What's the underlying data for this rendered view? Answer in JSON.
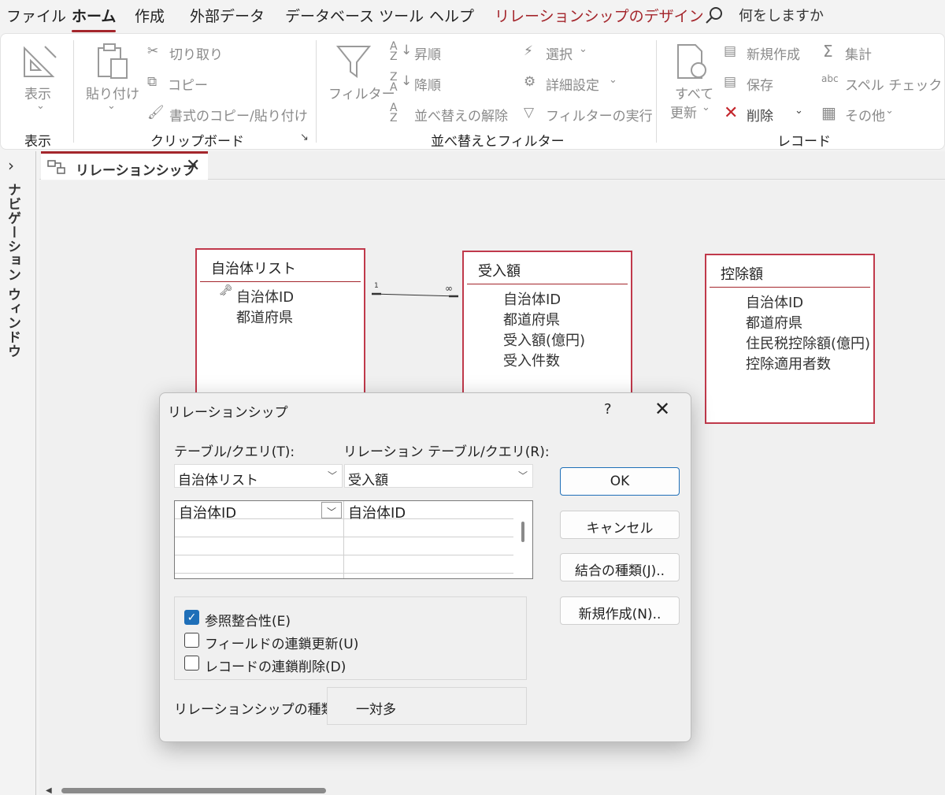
{
  "menu": {
    "tabs": [
      "ファイル",
      "ホーム",
      "作成",
      "外部データ",
      "データベース ツール",
      "ヘルプ",
      "リレーションシップのデザイン"
    ],
    "search": "何をしますか"
  },
  "ribbon": {
    "view": {
      "label": "表示",
      "group": "表示"
    },
    "clipboard": {
      "paste": "貼り付け",
      "cut": "切り取り",
      "copy": "コピー",
      "format_painter": "書式のコピー/貼り付け",
      "group": "クリップボード"
    },
    "sort_filter": {
      "filter": "フィルター",
      "ascending": "昇順",
      "descending": "降順",
      "remove_sort": "並べ替えの解除",
      "selection": "選択",
      "advanced": "詳細設定",
      "toggle_filter": "フィルターの実行",
      "group": "並べ替えとフィルター"
    },
    "records": {
      "refresh_line1": "すべて",
      "refresh_line2": "更新",
      "new": "新規作成",
      "save": "保存",
      "delete": "削除",
      "totals": "集計",
      "spelling": "スペル チェック",
      "more": "その他",
      "group": "レコード"
    }
  },
  "nav_pane": {
    "label": "ナビゲーション ウィンドウ"
  },
  "doc_tab": {
    "label": "リレーションシップ"
  },
  "tables": [
    {
      "title": "自治体リスト",
      "fields": [
        "自治体ID",
        "都道府県"
      ]
    },
    {
      "title": "受入額",
      "fields": [
        "自治体ID",
        "都道府県",
        "受入額(億円)",
        "受入件数"
      ]
    },
    {
      "title": "控除額",
      "fields": [
        "自治体ID",
        "都道府県",
        "住民税控除額(億円)",
        "控除適用者数"
      ]
    }
  ],
  "relationship_line": {
    "one_label": "1",
    "many_label": "∞"
  },
  "dialog": {
    "title": "リレーションシップ",
    "help": "?",
    "table_query_label": "テーブル/クエリ(T):",
    "related_table_label": "リレーション テーブル/クエリ(R):",
    "table_query_value": "自治体リスト",
    "related_table_value": "受入額",
    "field_left": "自治体ID",
    "field_right": "自治体ID",
    "buttons": {
      "ok": "OK",
      "cancel": "キャンセル",
      "join_type": "結合の種類(J)..",
      "create_new": "新規作成(N).."
    },
    "checkboxes": [
      {
        "label": "参照整合性(E)",
        "checked": true
      },
      {
        "label": "フィールドの連鎖更新(U)",
        "checked": false
      },
      {
        "label": "レコードの連鎖削除(D)",
        "checked": false
      }
    ],
    "relationship_type_label": "リレーションシップの種類：",
    "relationship_type_value": "一対多"
  },
  "colors": {
    "accent": "#a4262c",
    "table_border": "#c0394b",
    "primary_button": "#1f6fb8"
  }
}
